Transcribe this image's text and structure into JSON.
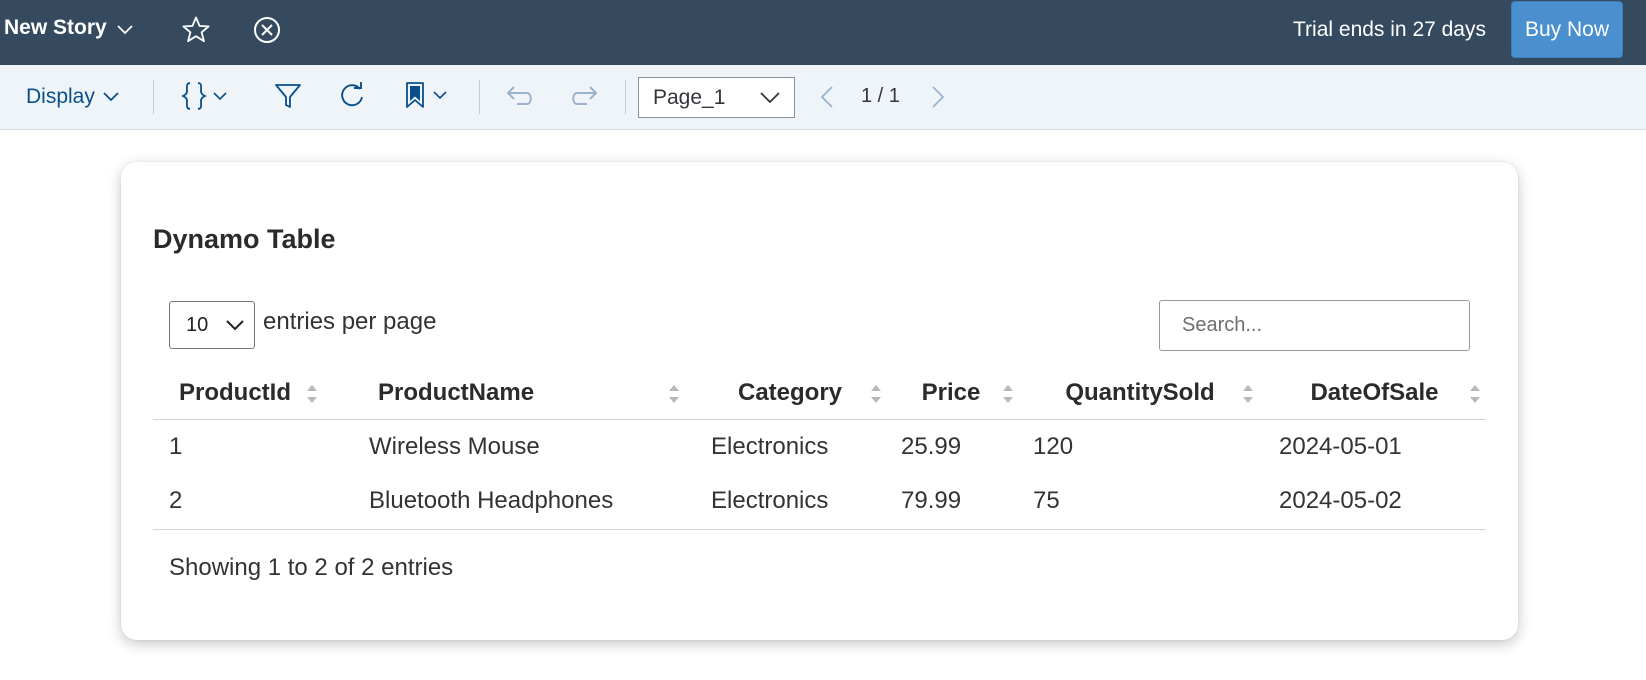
{
  "shellbar": {
    "story_title": "New Story",
    "trial_text": "Trial ends in 27 days",
    "buy_label": "Buy Now",
    "bg_color": "#354a5f",
    "buy_color": "#4a90cf",
    "icons": [
      "chevron-down-icon",
      "star-icon",
      "close-circle-icon"
    ]
  },
  "toolbar": {
    "display_label": "Display",
    "page_select_value": "Page_1",
    "page_indicator": "1 / 1",
    "icons": [
      "curly-braces-icon",
      "filter-icon",
      "refresh-icon",
      "bookmark-icon",
      "undo-icon",
      "redo-icon",
      "chevron-left-icon",
      "chevron-right-icon"
    ]
  },
  "card": {
    "title": "Dynamo Table",
    "entries_value": "10",
    "entries_label": "entries per page",
    "search_placeholder": "Search...",
    "columns": [
      "ProductId",
      "ProductName",
      "Category",
      "Price",
      "QuantitySold",
      "DateOfSale"
    ],
    "rows": [
      [
        "1",
        "Wireless Mouse",
        "Electronics",
        "25.99",
        "120",
        "2024-05-01"
      ],
      [
        "2",
        "Bluetooth Headphones",
        "Electronics",
        "79.99",
        "75",
        "2024-05-02"
      ]
    ],
    "footer": "Showing 1 to 2 of 2 entries"
  }
}
